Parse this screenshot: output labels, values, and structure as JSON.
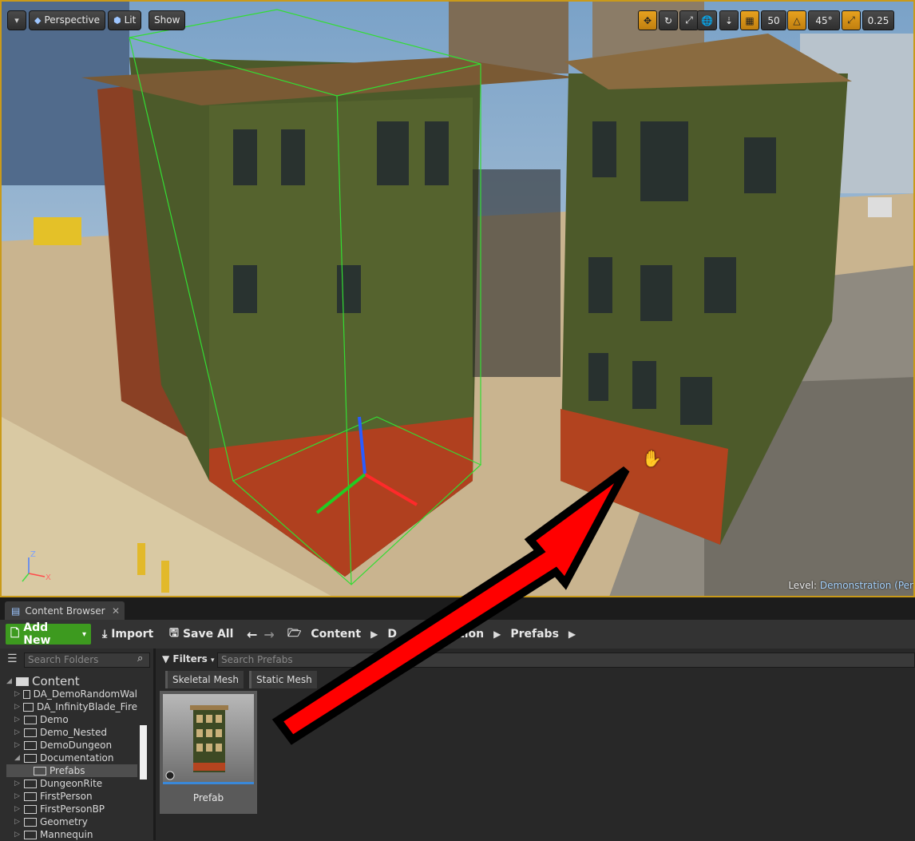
{
  "viewport": {
    "view_mode": "Perspective",
    "lighting": "Lit",
    "show": "Show",
    "grid_snap_value": "50",
    "rotation_snap_value": "45°",
    "scale_snap_value": "0.25",
    "level_prefix": "Level:",
    "level_name": "Demonstration (Per",
    "axis_x": "X",
    "axis_z": "Z"
  },
  "content_browser": {
    "tab_title": "Content Browser",
    "toolbar": {
      "add_new": "Add New",
      "import": "Import",
      "save_all": "Save All"
    },
    "breadcrumb": [
      "Content",
      "Documentation",
      "Prefabs"
    ],
    "breadcrumb_visible_middle": "D",
    "breadcrumb_visible_tail": "ation",
    "folder_search_placeholder": "Search Folders",
    "asset_search_placeholder": "Search Prefabs",
    "filters_label": "Filters",
    "filter_chips": [
      "Skeletal Mesh",
      "Static Mesh"
    ],
    "tree": [
      {
        "label": "Content",
        "level": 0,
        "expanded": true
      },
      {
        "label": "DA_DemoRandomWal",
        "level": 1
      },
      {
        "label": "DA_InfinityBlade_Fire",
        "level": 1
      },
      {
        "label": "Demo",
        "level": 1
      },
      {
        "label": "Demo_Nested",
        "level": 1
      },
      {
        "label": "DemoDungeon",
        "level": 1
      },
      {
        "label": "Documentation",
        "level": 1,
        "expanded": true
      },
      {
        "label": "Prefabs",
        "level": 2,
        "selected": true
      },
      {
        "label": "DungeonRite",
        "level": 1
      },
      {
        "label": "FirstPerson",
        "level": 1
      },
      {
        "label": "FirstPersonBP",
        "level": 1
      },
      {
        "label": "Geometry",
        "level": 1
      },
      {
        "label": "Mannequin",
        "level": 1
      }
    ],
    "asset": {
      "label": "Prefab"
    }
  },
  "colors": {
    "viewport_border": "#c99a1a",
    "add_new_green": "#3d9a1f",
    "snap_active": "#e7a21f",
    "arrow_red": "#ff0000",
    "selection_box": "#33dd33"
  }
}
